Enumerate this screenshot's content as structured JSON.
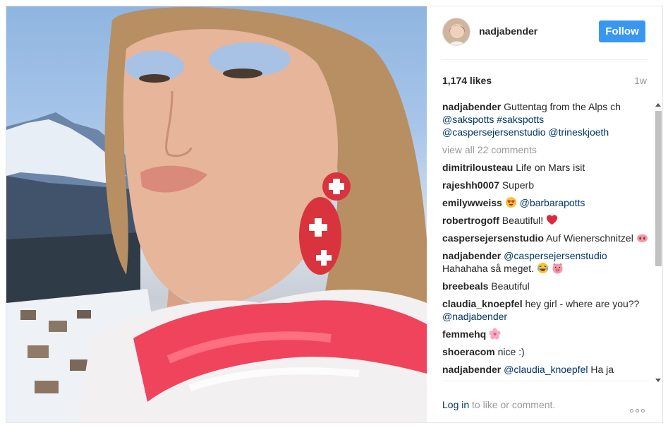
{
  "post": {
    "username": "nadjabender",
    "follow_label": "Follow",
    "likes": "1,174 likes",
    "age": "1w"
  },
  "caption": {
    "user": "nadjabender",
    "text": " Guttentag from the Alps ch",
    "links": [
      "@sakspotts",
      "#sakspotts",
      "@caspersejersenstudio",
      "@trineskjoeth"
    ]
  },
  "view_all": "view all 22 comments",
  "comments": [
    {
      "user": "dimitrilousteau",
      "text": " Life on Mars isit"
    },
    {
      "user": "rajeshh0007",
      "text": " Superb"
    },
    {
      "user": "emilywweiss",
      "emoji": "heart-eyes-emoji",
      "mention": "@barbarapotts"
    },
    {
      "user": "robertrogoff",
      "text": " Beautiful!",
      "emoji": "red-heart-emoji"
    },
    {
      "user": "caspersejersenstudio",
      "text": " Auf Wienerschnitzel",
      "emoji": "pig-nose-emoji"
    },
    {
      "user": "nadjabender",
      "mention": "@caspersejersenstudio",
      "text": "Hahahaha så meget.",
      "emoji": "tears-of-joy-emoji",
      "emoji2": "pig-face-emoji"
    },
    {
      "user": "breebeals",
      "text": " Beautiful"
    },
    {
      "user": "claudia_knoepfel",
      "text": " hey girl - where are you??",
      "mention": "@nadjabender"
    },
    {
      "user": "femmehq",
      "emoji": "cherry-blossom-emoji"
    },
    {
      "user": "shoeracom",
      "text": " nice :)"
    },
    {
      "user": "nadjabender",
      "mention": "@claudia_knoepfel",
      "text": " Ha ja"
    }
  ],
  "footer": {
    "login_link": "Log in",
    "login_rest": " to like or comment."
  }
}
